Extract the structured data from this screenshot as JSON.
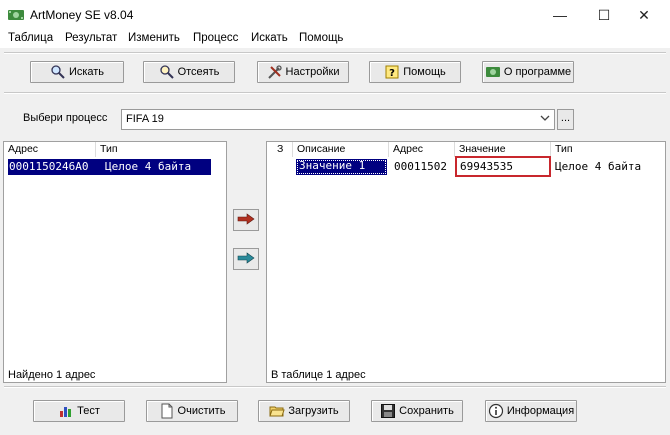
{
  "window": {
    "title": "ArtMoney SE v8.04",
    "minimize_glyph": "—",
    "maximize_glyph": "☐",
    "close_glyph": "✕"
  },
  "menu": {
    "items": [
      "Таблица",
      "Результат",
      "Изменить",
      "Процесс",
      "Искать",
      "Помощь"
    ]
  },
  "toolbar": {
    "search": "Искать",
    "filter": "Отсеять",
    "settings": "Настройки",
    "help": "Помощь",
    "about": "О программе"
  },
  "process": {
    "label": "Выбери процесс",
    "selected": "FIFA 19",
    "more_label": "..."
  },
  "left_panel": {
    "columns": [
      "Адрес",
      "Тип"
    ],
    "rows": [
      {
        "address": "0001150246A0",
        "type": "Целое 4 байта"
      }
    ],
    "status": "Найдено 1 адрес"
  },
  "right_panel": {
    "columns": [
      "З",
      "Описание",
      "Адрес",
      "Значение",
      "Тип"
    ],
    "rows": [
      {
        "freeze": "",
        "description": "Значение 1",
        "address": "00011502",
        "value": "69943535",
        "type": "Целое 4 байта"
      }
    ],
    "status": "В таблице 1 адрес"
  },
  "bottom_toolbar": {
    "test": "Тест",
    "clear": "Очистить",
    "load": "Загрузить",
    "save": "Сохранить",
    "info": "Информация"
  },
  "colors": {
    "selection": "#000080",
    "highlight": "#c8272d",
    "arrow_right": "#b03020",
    "arrow_left": "#2a8a9a"
  }
}
